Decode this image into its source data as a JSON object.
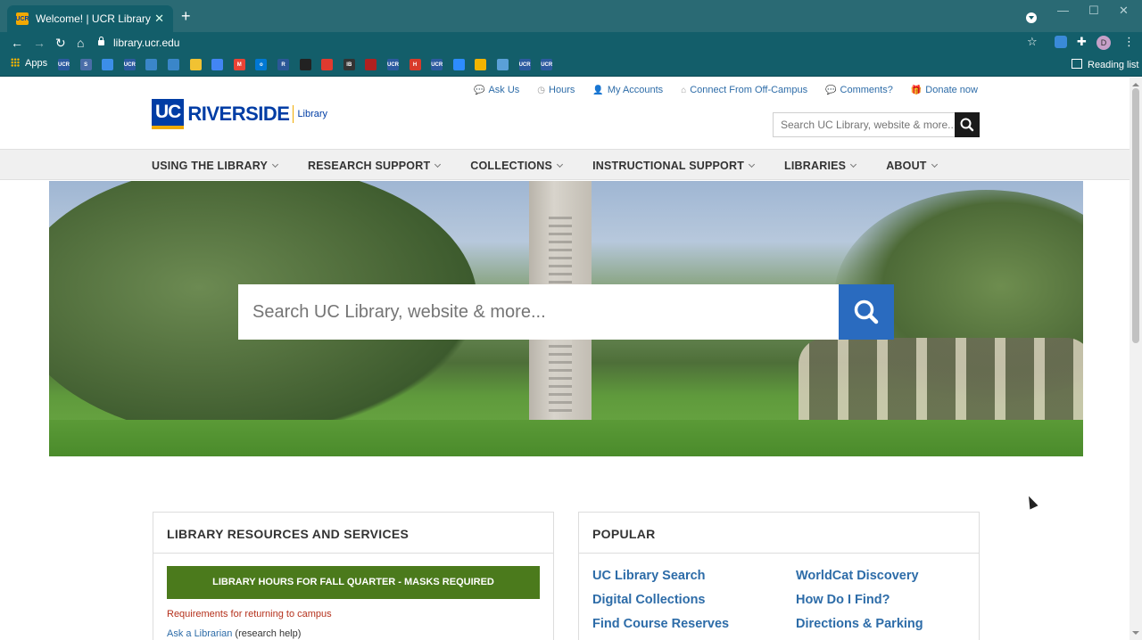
{
  "browser": {
    "tab_title": "Welcome! | UCR Library",
    "favicon_text": "UCR",
    "new_tab": "+",
    "url": "library.ucr.edu",
    "apps_label": "Apps",
    "reading_list_label": "Reading list",
    "profile_initial": "D"
  },
  "bookmark_icons": [
    {
      "name": "ucr-bookmark-icon",
      "color": "#2c5aa0",
      "text": "UCR"
    },
    {
      "name": "s-bookmark-icon",
      "color": "#4a6da8",
      "text": "S"
    },
    {
      "name": "ring-bookmark-icon",
      "color": "#3c8ee8"
    },
    {
      "name": "ucr2-bookmark-icon",
      "color": "#2c5aa0",
      "text": "UCR"
    },
    {
      "name": "card-bookmark-icon",
      "color": "#3a86c9"
    },
    {
      "name": "card2-bookmark-icon",
      "color": "#3a86c9"
    },
    {
      "name": "note-bookmark-icon",
      "color": "#f1c232"
    },
    {
      "name": "docs-bookmark-icon",
      "color": "#4285f4"
    },
    {
      "name": "gmail-bookmark-icon",
      "color": "#ea4335",
      "text": "M"
    },
    {
      "name": "outlook-bookmark-icon",
      "color": "#0078d4",
      "text": "o"
    },
    {
      "name": "r-bookmark-icon",
      "color": "#2b5797",
      "text": "R"
    },
    {
      "name": "black-bookmark-icon",
      "color": "#222222"
    },
    {
      "name": "circle-bookmark-icon",
      "color": "#e03a2f"
    },
    {
      "name": "ib-bookmark-icon",
      "color": "#333333",
      "text": "IB"
    },
    {
      "name": "red-circle-bookmark-icon",
      "color": "#b02020"
    },
    {
      "name": "ucr3-bookmark-icon",
      "color": "#2c5aa0",
      "text": "UCR"
    },
    {
      "name": "h-bookmark-icon",
      "color": "#d83a2a",
      "text": "H"
    },
    {
      "name": "ucr4-bookmark-icon",
      "color": "#2c5aa0",
      "text": "UCR"
    },
    {
      "name": "zoom-bookmark-icon",
      "color": "#2d8cff"
    },
    {
      "name": "chrome-bookmark-icon",
      "color": "#f2b400"
    },
    {
      "name": "globe-bookmark-icon",
      "color": "#5aa0d8"
    },
    {
      "name": "ucr5-bookmark-icon",
      "color": "#2c5aa0",
      "text": "UCR"
    },
    {
      "name": "ucr6-bookmark-icon",
      "color": "#2c5aa0",
      "text": "UCR"
    }
  ],
  "logo": {
    "uc": "UC",
    "riverside": "RIVERSIDE",
    "library": "Library"
  },
  "util_nav": [
    {
      "icon": "chat-icon",
      "glyph": "💬",
      "label": "Ask Us"
    },
    {
      "icon": "clock-icon",
      "glyph": "◷",
      "label": "Hours"
    },
    {
      "icon": "user-icon",
      "glyph": "👤",
      "label": "My Accounts"
    },
    {
      "icon": "home-icon",
      "glyph": "⌂",
      "label": "Connect From Off-Campus"
    },
    {
      "icon": "comment-icon",
      "glyph": "💬",
      "label": "Comments?"
    },
    {
      "icon": "gift-icon",
      "glyph": "🎁",
      "label": "Donate now"
    }
  ],
  "header_search": {
    "placeholder": "Search UC Library, website & more..."
  },
  "main_nav": [
    "USING THE LIBRARY",
    "RESEARCH SUPPORT",
    "COLLECTIONS",
    "INSTRUCTIONAL SUPPORT",
    "LIBRARIES",
    "ABOUT"
  ],
  "hero_search": {
    "placeholder": "Search UC Library, website & more..."
  },
  "resources": {
    "heading": "LIBRARY RESOURCES AND SERVICES",
    "hours_button": "LIBRARY HOURS FOR FALL QUARTER - MASKS REQUIRED",
    "requirements": "Requirements for returning to campus",
    "ask_link": "Ask a Librarian",
    "ask_suffix": " (research help)"
  },
  "popular": {
    "heading": "POPULAR",
    "links": [
      "UC Library Search",
      "WorldCat Discovery",
      "Digital Collections",
      "How Do I Find?",
      "Find Course Reserves",
      "Directions & Parking"
    ]
  },
  "colors": {
    "browser_teal": "#135e6a",
    "ucr_blue": "#003da5",
    "ucr_gold": "#f1ab00",
    "link_blue": "#2d6ca8",
    "hours_green": "#4b7a1c",
    "hero_search_blue": "#2a6bbf"
  }
}
